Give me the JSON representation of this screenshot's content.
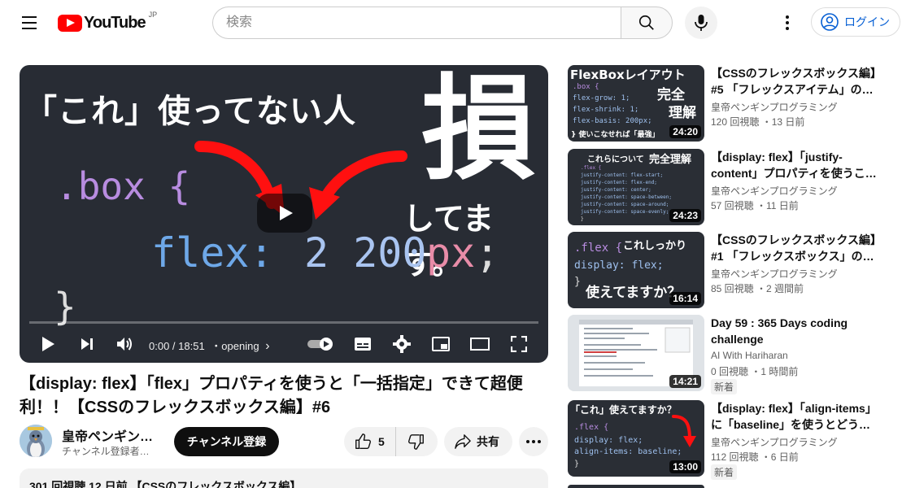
{
  "header": {
    "logo_text": "YouTube",
    "logo_region": "JP",
    "search_placeholder": "検索",
    "login_label": "ログイン"
  },
  "player": {
    "thumb_line1": "「これ」使ってない人",
    "thumb_big": "損",
    "thumb_line2": "してます。",
    "code_selector": ".box {",
    "code_prop": "flex:",
    "code_value": "2 200",
    "code_unit": "px",
    "code_semi": ";",
    "code_close": "}",
    "time": "0:00 / 18:51",
    "chapter": "・opening",
    "chapter_arrow": "›"
  },
  "video": {
    "title": "【display: flex】「flex」プロパティを使うと「一括指定」できて超便利！！【CSSのフレックスボックス編】#6",
    "channel_name": "皇帝ペンギン…",
    "channel_subs": "チャンネル登録者…",
    "subscribe_label": "チャンネル登録",
    "like_count": "5",
    "share_label": "共有",
    "description_preview": "301 回視聴  12 日前  【CSSのフレックスボックス編】"
  },
  "recommendations": [
    {
      "title": "【CSSのフレックスボックス編】#5 「フレックスアイテム」の…",
      "channel": "皇帝ペンギンプログラミング",
      "meta": "120 回視聴 ・13 日前",
      "duration": "24:20",
      "thumb_heading": "FlexBoxレイアウト",
      "thumb_badge1": "完全",
      "thumb_badge2": "理解",
      "thumb_code": [
        ".box {",
        "  flex-grow: 1;",
        "  flex-shrink: 1;",
        "  flex-basis: 200px;"
      ],
      "thumb_footer": "} 使いこなせれば「最強」"
    },
    {
      "title": "【display: flex】「justify-content」プロパティを使うこ…",
      "channel": "皇帝ペンギンプログラミング",
      "meta": "57 回視聴 ・11 日前",
      "duration": "24:23",
      "thumb_heading": "これらについて",
      "thumb_badge1": "完全理解",
      "thumb_code": [
        ".flex {",
        "  justify-content: flex-start;",
        "  justify-content: flex-end;",
        "  justify-content: center;",
        "  justify-content: space-between;",
        "  justify-content: space-around;",
        "  justify-content: space-evenly;",
        "}"
      ]
    },
    {
      "title": "【CSSのフレックスボックス編】#1 「フレックスボックス」の…",
      "channel": "皇帝ペンギンプログラミング",
      "meta": "85 回視聴 ・2 週間前",
      "duration": "16:14",
      "thumb_heading": "これしっかり",
      "thumb_footer": "使えてますか？",
      "thumb_code": [
        ".flex {",
        "  display: flex;",
        "}"
      ]
    },
    {
      "title": "Day 59 : 365 Days coding challenge",
      "channel": "AI With Hariharan",
      "meta": "0 回視聴 ・1 時間前",
      "badge": "新着",
      "duration": "14:21"
    },
    {
      "title": "【display: flex】「align-items」に「baseline」を使うとどう…",
      "channel": "皇帝ペンギンプログラミング",
      "meta": "112 回視聴 ・6 日前",
      "badge": "新着",
      "duration": "13:00",
      "thumb_heading": "「これ」使えてますか？",
      "thumb_code": [
        ".flex {",
        "  display: flex;",
        "  align-items: baseline;",
        "}"
      ]
    }
  ],
  "colors": {
    "brand_red": "#ff0000",
    "link_blue": "#065fd4",
    "code_purple": "#b88ce0",
    "code_blue": "#6ea8e8",
    "code_pink": "#e88ca8"
  }
}
